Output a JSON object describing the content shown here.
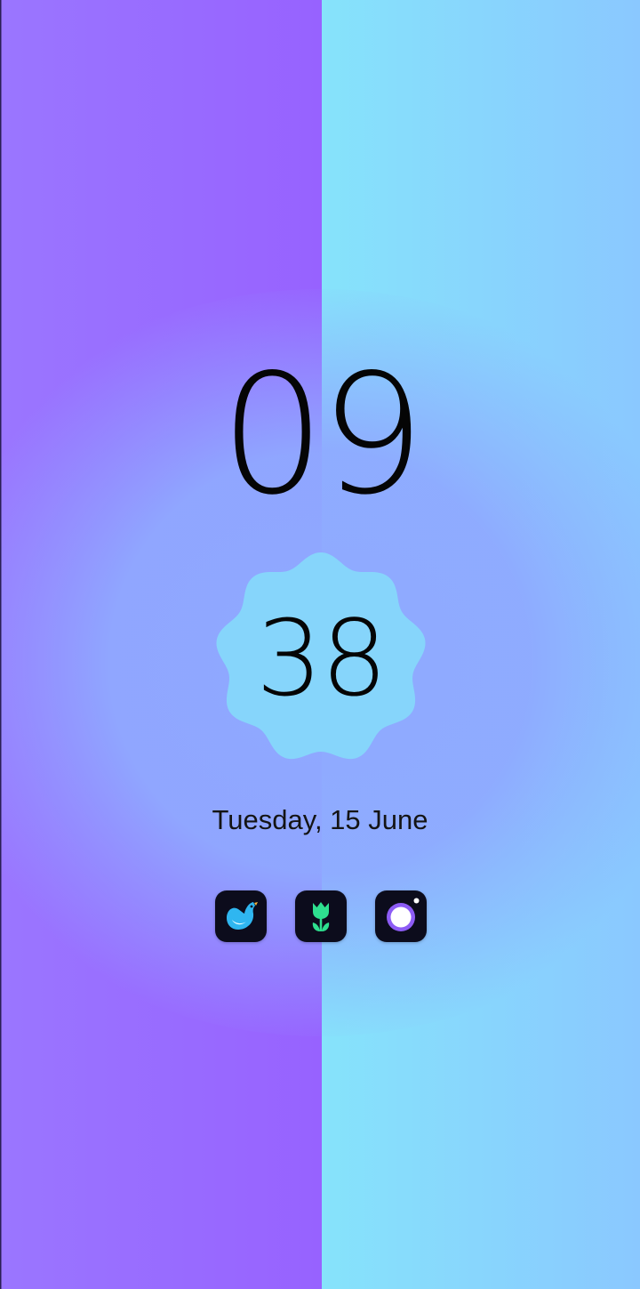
{
  "lockscreen": {
    "clock_hours": "09",
    "clock_minutes": "38",
    "date": "Tuesday, 15 June"
  },
  "shortcuts": [
    {
      "name": "bird-app",
      "icon": "bird-icon"
    },
    {
      "name": "tulip-app",
      "icon": "tulip-icon"
    },
    {
      "name": "camera-app",
      "icon": "camera-icon"
    }
  ],
  "colors": {
    "wallpaper_left": "#9b6bff",
    "wallpaper_right": "#86def9",
    "wallpaper_center": "#8fa8ff",
    "minutes_badge": "#86d5fb",
    "icon_background": "#0c0c1c",
    "text": "#050505"
  }
}
